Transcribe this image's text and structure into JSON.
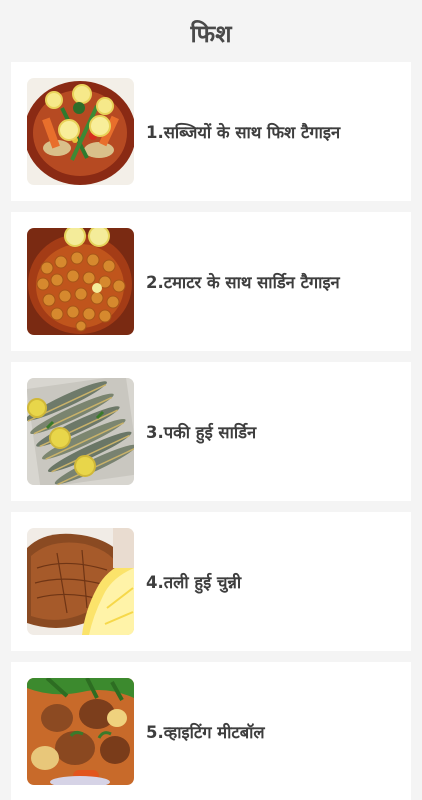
{
  "header": {
    "title": "फिश"
  },
  "recipes": [
    {
      "label": "1.सब्जियों के साथ फिश टैगाइन",
      "image": "fish-tagine-vegetables-image"
    },
    {
      "label": "2.टमाटर के साथ सार्डिन टैगाइन",
      "image": "sardine-tagine-tomato-image"
    },
    {
      "label": "3.पकी हुई सार्डिन",
      "image": "baked-sardines-image"
    },
    {
      "label": "4.तली हुई चुन्नी",
      "image": "fried-fish-image"
    },
    {
      "label": "5.व्हाइटिंग मीटबॉल",
      "image": "whiting-meatballs-image"
    }
  ]
}
